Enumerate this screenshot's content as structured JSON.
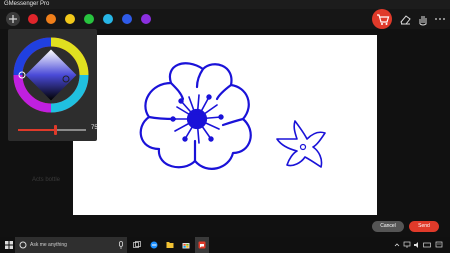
{
  "window": {
    "title": "GMessenger Pro"
  },
  "toolbar": {
    "add_icon": "plus-circle-icon",
    "swatches": [
      "#e0252b",
      "#f07f1a",
      "#f2c91a",
      "#28c43f",
      "#27b6e6",
      "#2f5be8",
      "#8b2fe0"
    ],
    "right_icons": [
      "cart-icon",
      "eraser-icon",
      "hand-icon",
      "more-icon"
    ],
    "accent": "#e03a2a"
  },
  "color_picker": {
    "slider_value": "75",
    "slider_fraction": 0.55
  },
  "background_chat": {
    "line1": "Acts bottle"
  },
  "actions": {
    "cancel_label": "Cancel",
    "send_label": "Send"
  },
  "taskbar": {
    "search_placeholder": "Ask me anything"
  },
  "drawing": {
    "stroke_color": "#1a12d8"
  }
}
